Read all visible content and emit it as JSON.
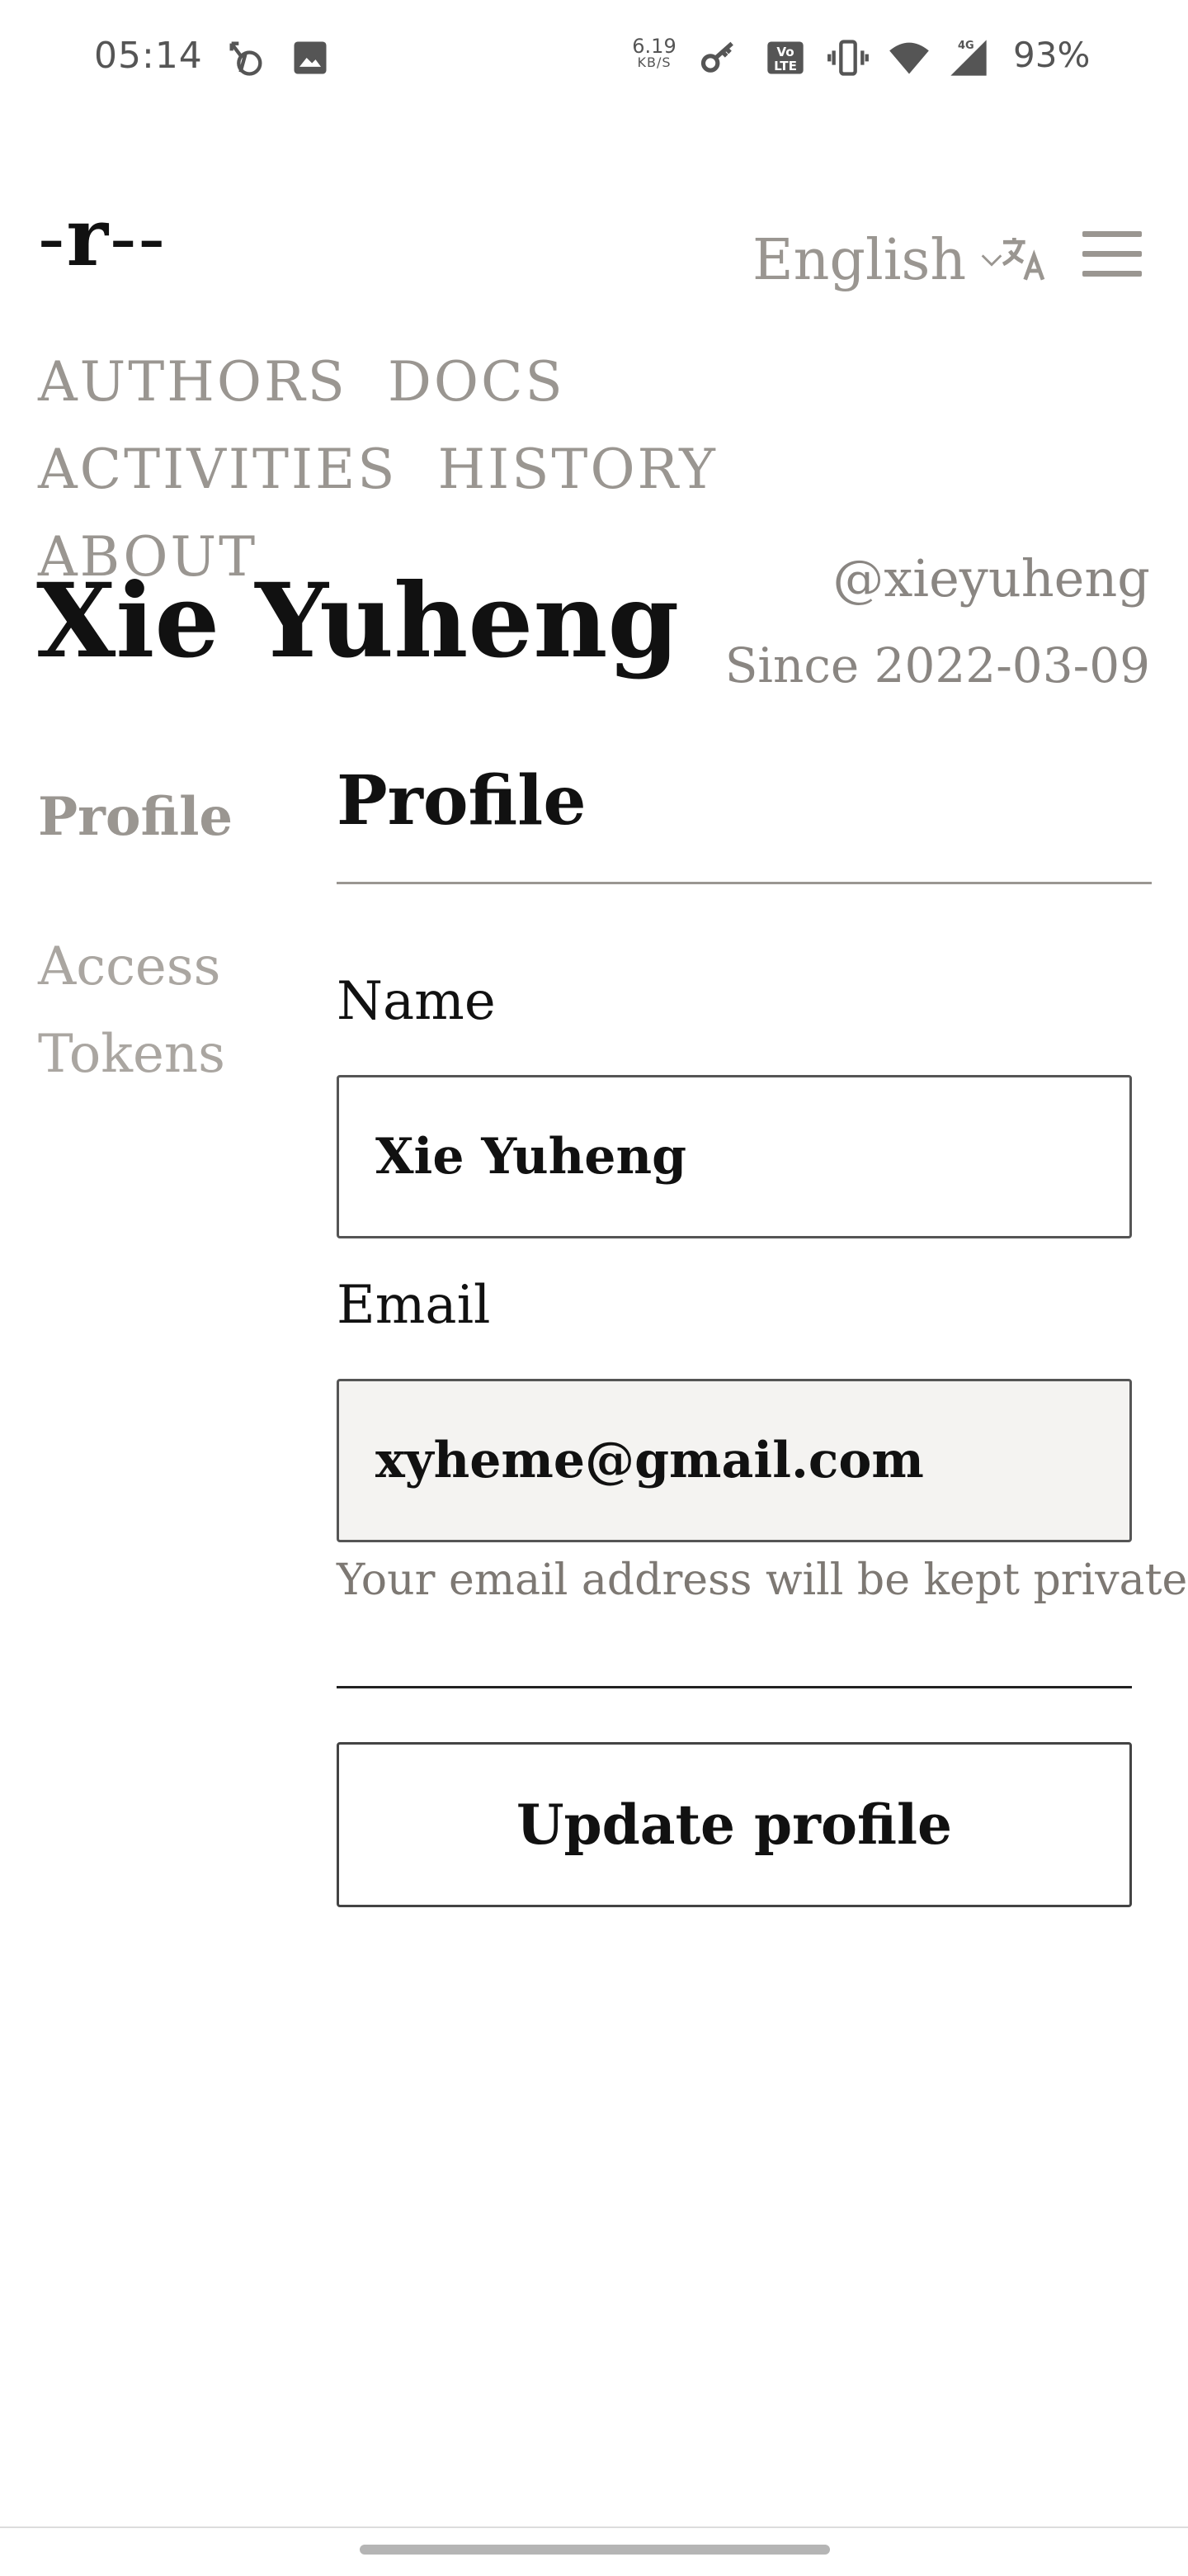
{
  "status_bar": {
    "time": "05:14",
    "net_speed_value": "6.19",
    "net_speed_unit": "KB/S",
    "battery": "93%",
    "icons": [
      "no-wifi-calling-icon",
      "image-icon",
      "vpn-key-icon",
      "volte-icon",
      "vibrate-icon",
      "wifi-icon",
      "signal-4g-icon"
    ]
  },
  "header": {
    "logo_dash_left": "-",
    "logo_letter": "r",
    "logo_dash_right": "--",
    "language": "English"
  },
  "nav": {
    "items": [
      "AUTHORS",
      "DOCS",
      "ACTIVITIES",
      "HISTORY",
      "ABOUT"
    ]
  },
  "author": {
    "name": "Xie Yuheng",
    "handle": "@xieyuheng",
    "since": "Since 2022-03-09"
  },
  "side_menu": {
    "profile": "Profile",
    "access_tokens": "Access Tokens"
  },
  "form": {
    "title": "Profile",
    "name_label": "Name",
    "name_value": "Xie Yuheng",
    "email_label": "Email",
    "email_value": "xyheme@gmail.com",
    "email_help": "Your email address will be kept private.",
    "submit_label": "Update profile"
  },
  "colors": {
    "muted": "#9a9691",
    "text": "#111111",
    "readonly_bg": "#f4f3f1"
  }
}
